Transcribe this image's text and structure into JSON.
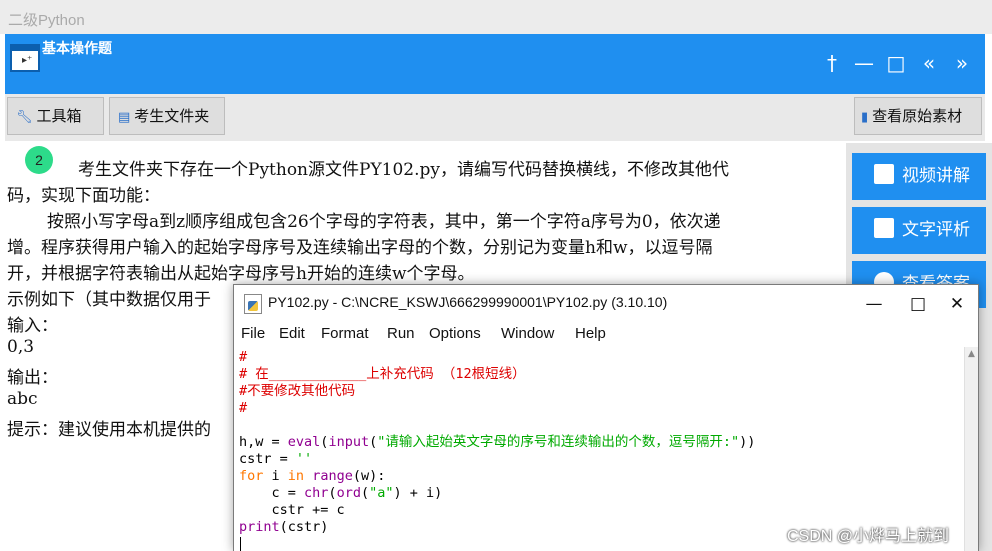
{
  "app": {
    "title": "二级Python"
  },
  "header": {
    "title": "基本操作题",
    "controls": [
      "pin-icon",
      "minimize-icon",
      "maximize-icon",
      "collapse-left-icon",
      "collapse-right-icon"
    ]
  },
  "toolbar": {
    "toolbox_label": "工具箱",
    "folder_label": "考生文件夹",
    "source_label": "查看原始素材"
  },
  "question": {
    "number": "2",
    "lines": [
      "考生文件夹下存在一个Python源文件PY102.py，请编写代码替换横线，不修改其他代",
      "码，实现下面功能：",
      "按照小写字母a到z顺序组成包含26个字母的字符表，其中，第一个字符a序号为0，依次递",
      "增。程序获得用户输入的起始字母序号及连续输出字母的个数，分别记为变量h和w，以逗号隔",
      "开，并根据字符表输出从起始字母序号h开始的连续w个字母。",
      "示例如下（其中数据仅用于",
      "输入：",
      "0,3",
      "输出：",
      "abc",
      "提示：建议使用本机提供的"
    ]
  },
  "side": {
    "video_label": "视频讲解",
    "text_label": "文字评析",
    "answer_label": "查看答案"
  },
  "editor": {
    "title": "PY102.py - C:\\NCRE_KSWJ\\666299990001\\PY102.py (3.10.10)",
    "menu": [
      "File",
      "Edit",
      "Format",
      "Run",
      "Options",
      "Window",
      "Help"
    ],
    "code": [
      "#",
      "# 在____________上补充代码 （12根短线）",
      "#不要修改其他代码",
      "#",
      "",
      "h,w = eval(input(\"请输入起始英文字母的序号和连续输出的个数，逗号隔开:\"))",
      "cstr = ''",
      "for i in range(w):",
      "    c = chr(ord(\"a\") + i)",
      "    cstr += c",
      "print(cstr)"
    ]
  },
  "watermark": "CSDN @小烨马上就到",
  "colors": {
    "accent": "#1f8ff0",
    "badge": "#2ddb8a"
  }
}
